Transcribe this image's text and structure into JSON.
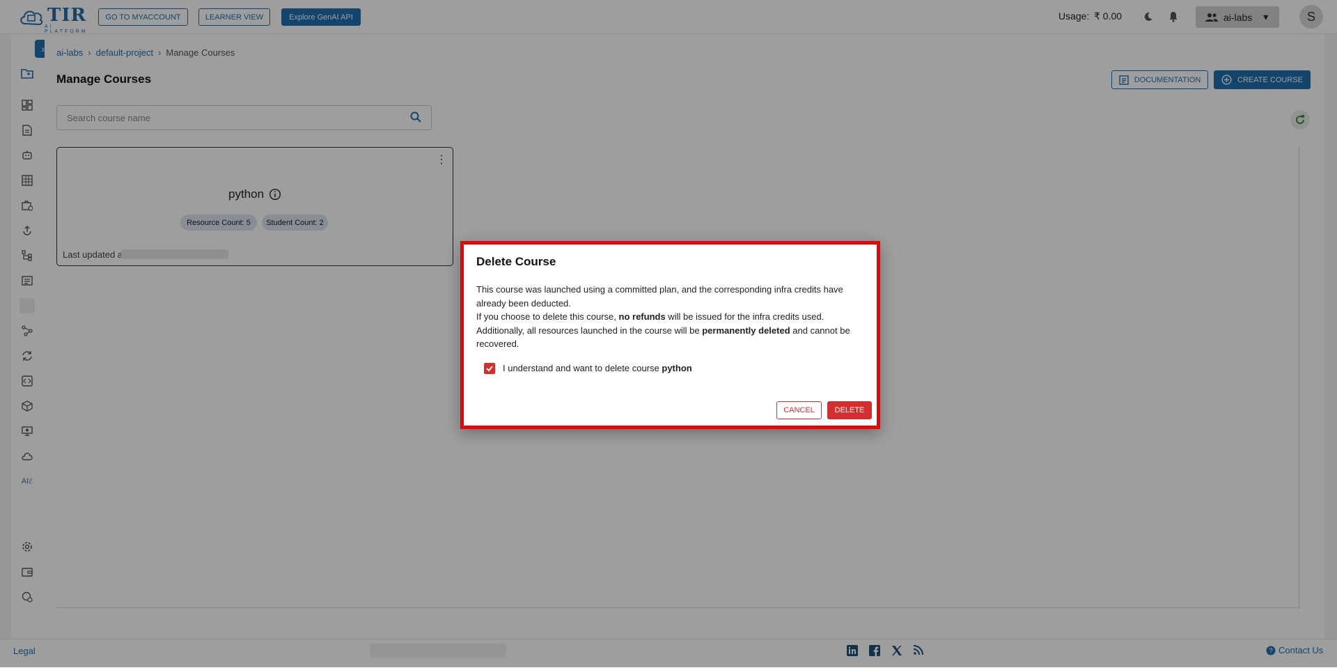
{
  "header": {
    "logo_text": "TIR",
    "logo_sub": "AI PLATFORM",
    "buttons": [
      {
        "label": "GO TO MYACCOUNT"
      },
      {
        "label": "LEARNER VIEW"
      },
      {
        "label": "Explore GenAI API"
      }
    ],
    "usage_label": "Usage:",
    "usage_value": "₹ 0.00",
    "team": "ai-labs",
    "avatar_initial": "S"
  },
  "sidebar": {
    "expand_icon": "double-chevron-right-icon",
    "items": [
      {
        "icon": "folder-icon"
      },
      {
        "icon": "dashboard-icon"
      },
      {
        "icon": "document-icon"
      },
      {
        "icon": "robot-icon"
      },
      {
        "icon": "grid-icon"
      },
      {
        "icon": "briefcase-icon"
      },
      {
        "icon": "deploy-icon"
      },
      {
        "icon": "tree-icon"
      },
      {
        "icon": "table-icon"
      },
      {
        "icon": "blank-icon"
      },
      {
        "icon": "pipeline-icon"
      },
      {
        "icon": "sync-icon"
      },
      {
        "icon": "code-box-icon"
      },
      {
        "icon": "cube-icon"
      },
      {
        "icon": "monitor-icon"
      },
      {
        "icon": "cloud-icon"
      },
      {
        "icon": "ai-labs-icon",
        "label": "AI"
      }
    ],
    "bottom": [
      {
        "icon": "gear-icon"
      },
      {
        "icon": "wallet-icon"
      },
      {
        "icon": "support-icon"
      }
    ]
  },
  "breadcrumb": {
    "items": [
      "ai-labs",
      "default-project"
    ],
    "current": "Manage Courses"
  },
  "page_title": "Manage Courses",
  "toolbar": {
    "documentation_label": "DOCUMENTATION",
    "create_label": "CREATE COURSE"
  },
  "search": {
    "placeholder": "Search course name",
    "value": ""
  },
  "course_card": {
    "name": "python",
    "resource_count": "Resource Count: 5",
    "student_count": "Student Count: 2",
    "updated_prefix": "Last updated a"
  },
  "footer": {
    "legal": "Legal",
    "contact": "Contact Us"
  },
  "dialog": {
    "title": "Delete Course",
    "line1": "This course was launched using a committed plan, and the corresponding infra credits have already been deducted.",
    "line2_a": "If you choose to delete this course, ",
    "line2_b": "no refunds",
    "line2_c": " will be issued for the infra credits used.",
    "line3_a": "Additionally, all resources launched in the course will be ",
    "line3_b": "permanently deleted",
    "line3_c": " and cannot be recovered.",
    "checkbox_label": "I understand and want to delete course ",
    "checkbox_course": "python",
    "checked": true,
    "cancel_label": "CANCEL",
    "delete_label": "DELETE"
  },
  "colors": {
    "primary": "#1f6fae",
    "danger": "#d32f2f",
    "highlight": "#ee0000"
  }
}
